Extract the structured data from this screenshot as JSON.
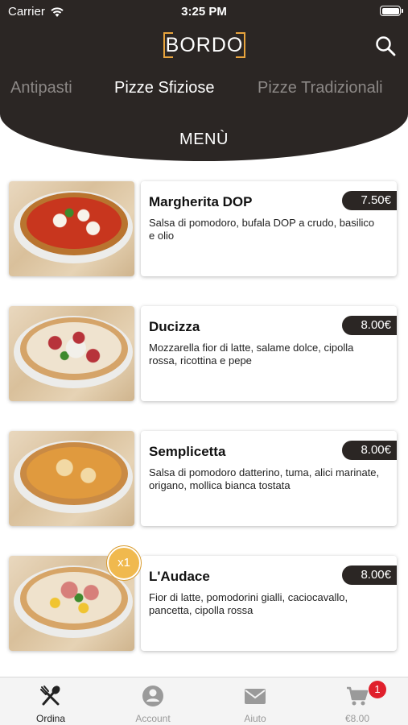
{
  "status_bar": {
    "carrier": "Carrier",
    "time": "3:25 PM"
  },
  "header": {
    "logo": "BORDO",
    "categories": [
      "Antipasti",
      "Pizze Sfiziose",
      "Pizze Tradizionali"
    ],
    "active_category": "Pizze Sfiziose",
    "section_title": "MENÙ"
  },
  "items": [
    {
      "name": "Margherita DOP",
      "price": "7.50€",
      "description": "Salsa di pomodoro, bufala DOP a crudo, basilico e olio"
    },
    {
      "name": "Ducizza",
      "price": "8.00€",
      "description": "Mozzarella fior di latte, salame dolce, cipolla rossa, ricottina e pepe"
    },
    {
      "name": "Semplicetta",
      "price": "8.00€",
      "description": "Salsa di pomodoro datterino, tuma, alici marinate, origano, mollica bianca tostata"
    },
    {
      "name": "L'Audace",
      "price": "8.00€",
      "description": "Fior di latte, pomodorini gialli, caciocavallo, pancetta, cipolla rossa",
      "quantity_badge": "x1"
    }
  ],
  "tabbar": {
    "tabs": [
      {
        "label": "Ordina",
        "icon": "fork-spoon-icon"
      },
      {
        "label": "Account",
        "icon": "account-icon"
      },
      {
        "label": "Aiuto",
        "icon": "mail-icon"
      },
      {
        "label": "€8.00",
        "icon": "cart-icon"
      }
    ],
    "active_tab": "Ordina",
    "cart_count": "1"
  },
  "colors": {
    "header_bg": "#2b2624",
    "logo_accent": "#e8a43d",
    "badge_orange": "#f0b94e",
    "cart_badge_red": "#e0202c"
  }
}
